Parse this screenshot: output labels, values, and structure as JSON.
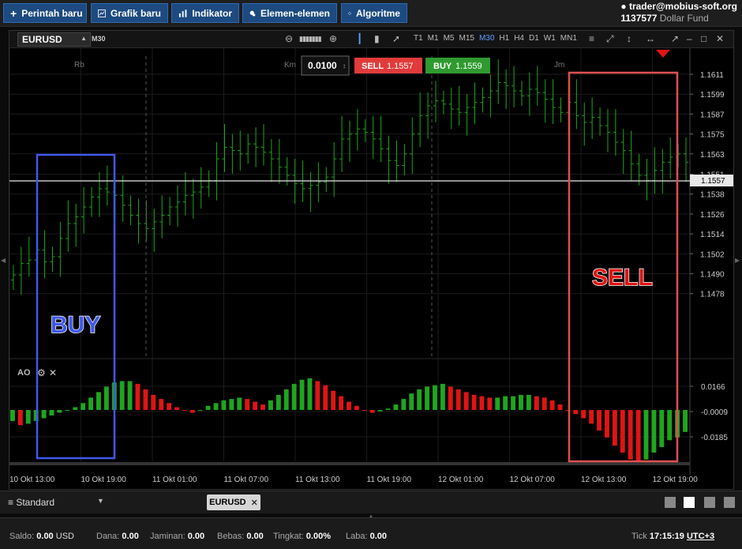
{
  "toolbar": {
    "new_order": "Perintah baru",
    "new_chart": "Grafik baru",
    "indicators": "Indikator",
    "elements": "Elemen-elemen",
    "algorithm": "Algoritme"
  },
  "account": {
    "email": "trader@mobius-soft.org",
    "number": "1137577",
    "fund": "Dollar Fund"
  },
  "chart": {
    "symbol": "EURUSD",
    "timeframe": "M30",
    "timeframes": [
      "T1",
      "M1",
      "M5",
      "M15",
      "M30",
      "H1",
      "H4",
      "D1",
      "W1",
      "MN1"
    ],
    "active_timeframe": "M30",
    "day_labels": [
      "Rb",
      "Km",
      "Jm"
    ],
    "lot": "0.0100",
    "sell_label": "SELL",
    "sell_price": "1.1557",
    "buy_label": "BUY",
    "buy_price": "1.1559",
    "current_price": "1.1557",
    "price_axis": [
      "1.1611",
      "1.1599",
      "1.1587",
      "1.1575",
      "1.1563",
      "1.1551",
      "1.1538",
      "1.1526",
      "1.1514",
      "1.1502",
      "1.1490",
      "1.1478"
    ],
    "ao_label": "AO",
    "ao_axis": [
      "0.0166",
      "-0.0009",
      "-0.0185"
    ],
    "time_axis": [
      "10 Okt 13:00",
      "10 Okt 19:00",
      "11 Okt 01:00",
      "11 Okt 07:00",
      "11 Okt 13:00",
      "11 Okt 19:00",
      "12 Okt 01:00",
      "12 Okt 07:00",
      "12 Okt 13:00",
      "12 Okt 19:00"
    ],
    "buy_annotation": "BUY",
    "sell_annotation": "SELL",
    "colors": {
      "up": "#1fa51f",
      "down": "#e01414",
      "buy_box": "#3f58e8",
      "sell_box": "#e05050",
      "sell_btn": "#e13b3b",
      "buy_btn": "#2f9a2f"
    }
  },
  "chart_data": {
    "type": "bar",
    "title": "",
    "xlabel": "",
    "ylabel": "",
    "ylim": [
      1.1468,
      1.162
    ],
    "ohlc_series": [
      1.149,
      1.1497,
      1.1499,
      1.1505,
      1.1498,
      1.1501,
      1.1512,
      1.1521,
      1.1525,
      1.1531,
      1.1537,
      1.1542,
      1.154,
      1.1538,
      1.1532,
      1.1526,
      1.1521,
      1.1518,
      1.1522,
      1.1526,
      1.1531,
      1.1534,
      1.1538,
      1.154,
      1.1543,
      1.1547,
      1.156,
      1.1567,
      1.1565,
      1.1563,
      1.1569,
      1.1567,
      1.1564,
      1.156,
      1.1555,
      1.155,
      1.1545,
      1.1542,
      1.1544,
      1.1546,
      1.1549,
      1.156,
      1.1572,
      1.1575,
      1.1578,
      1.1576,
      1.1572,
      1.1566,
      1.1559,
      1.1556,
      1.1563,
      1.1575,
      1.1586,
      1.1592,
      1.1595,
      1.1593,
      1.159,
      1.1588,
      1.1591,
      1.1594,
      1.1597,
      1.1601,
      1.1606,
      1.1604,
      1.1601,
      1.1598,
      1.1602,
      1.16,
      1.1596,
      1.1591,
      1.1588,
      1.1594,
      1.1586,
      1.1582,
      1.1585,
      1.158,
      1.1576,
      1.157,
      1.1565,
      1.1557,
      1.155,
      1.1547,
      1.1553,
      1.1558,
      1.1561,
      1.1563,
      1.1558
    ],
    "ao_values": [
      -0.008,
      -0.011,
      -0.01,
      -0.008,
      -0.006,
      -0.004,
      -0.002,
      0.0,
      0.002,
      0.005,
      0.009,
      0.013,
      0.017,
      0.02,
      0.021,
      0.021,
      0.019,
      0.015,
      0.011,
      0.008,
      0.005,
      0.002,
      0.0,
      -0.002,
      0.0,
      0.003,
      0.005,
      0.007,
      0.008,
      0.009,
      0.008,
      0.006,
      0.004,
      0.007,
      0.011,
      0.015,
      0.019,
      0.022,
      0.023,
      0.021,
      0.018,
      0.014,
      0.01,
      0.006,
      0.003,
      0.0,
      -0.002,
      -0.001,
      0.001,
      0.004,
      0.008,
      0.012,
      0.015,
      0.017,
      0.018,
      0.019,
      0.017,
      0.015,
      0.013,
      0.011,
      0.01,
      0.009,
      0.009,
      0.01,
      0.01,
      0.011,
      0.011,
      0.01,
      0.009,
      0.007,
      0.004,
      0.0,
      -0.003,
      -0.006,
      -0.01,
      -0.015,
      -0.02,
      -0.026,
      -0.031,
      -0.036,
      -0.039,
      -0.036,
      -0.031,
      -0.027,
      -0.022,
      -0.02,
      -0.016
    ]
  },
  "tabs": {
    "preset": "Standard",
    "doc_tab": "EURUSD"
  },
  "status": {
    "saldo_label": "Saldo:",
    "saldo_value": "0.00",
    "saldo_currency": "USD",
    "dana_label": "Dana:",
    "dana_value": "0.00",
    "jaminan_label": "Jaminan:",
    "jaminan_value": "0.00",
    "bebas_label": "Bebas:",
    "bebas_value": "0.00",
    "tingkat_label": "Tingkat:",
    "tingkat_value": "0.00%",
    "laba_label": "Laba:",
    "laba_value": "0.00",
    "tick_label": "Tick",
    "time": "17:15:19",
    "timezone": "UTC+3"
  }
}
